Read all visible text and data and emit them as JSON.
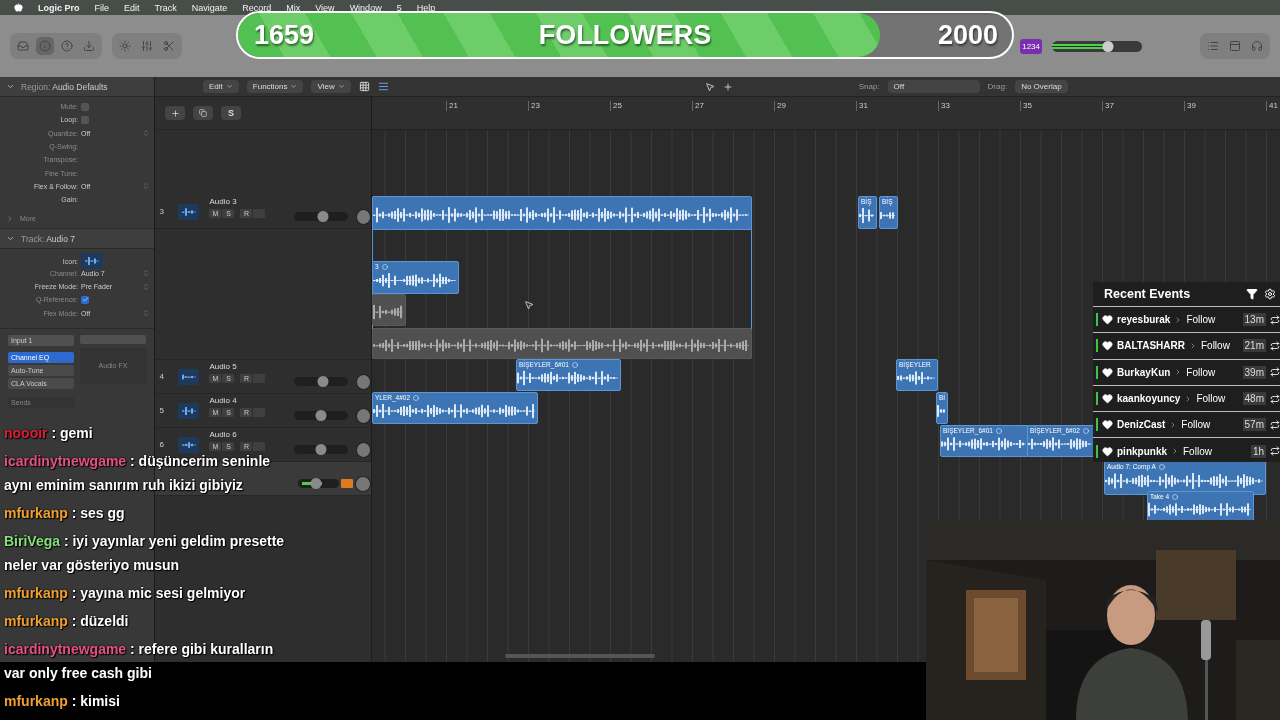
{
  "menu_bar": {
    "app": "Logic Pro",
    "items": [
      "File",
      "Edit",
      "Track",
      "Navigate",
      "Record",
      "Mix",
      "View",
      "Window",
      "5",
      "Help"
    ]
  },
  "followers_goal": {
    "current": "1659",
    "label": "FOLLOWERS",
    "goal": "2000",
    "level": 0.83
  },
  "control_bar": {
    "master_volume": {
      "level": 0.62
    },
    "badge": "1234"
  },
  "inspector": {
    "region_header": {
      "label": "Region:",
      "value": "Audio Defaults",
      "expanded": true
    },
    "region_rows": [
      {
        "label": "Mute:",
        "kind": "check",
        "checked": false,
        "disabled": true
      },
      {
        "label": "Loop:",
        "kind": "check",
        "checked": false,
        "disabled": false
      },
      {
        "label": "Quantize:",
        "kind": "value",
        "value": "Off",
        "disabled": true
      },
      {
        "label": "Q-Swing:",
        "kind": "blank",
        "disabled": true
      },
      {
        "label": "Transpose:",
        "kind": "blank",
        "disabled": true
      },
      {
        "label": "Fine Tune:",
        "kind": "blank",
        "disabled": true
      },
      {
        "label": "Flex & Follow:",
        "kind": "value",
        "value": "Off",
        "disabled": false
      },
      {
        "label": "Gain:",
        "kind": "blank",
        "disabled": false
      }
    ],
    "more": {
      "label": "More",
      "expanded": false
    },
    "track_header": {
      "label": "Track:",
      "value": "Audio 7",
      "expanded": true
    },
    "track_rows": [
      {
        "label": "Icon:",
        "kind": "icon",
        "disabled": false
      },
      {
        "label": "Channel:",
        "kind": "value",
        "value": "Audio 7",
        "disabled": true
      },
      {
        "label": "Freeze Mode:",
        "kind": "value",
        "value": "Pre Fader",
        "disabled": false
      },
      {
        "label": "Q-Reference:",
        "kind": "check",
        "checked": true,
        "disabled": true
      },
      {
        "label": "Flex Mode:",
        "kind": "value",
        "value": "Off",
        "disabled": true
      }
    ],
    "channel_strip": {
      "input": "Input 1",
      "plugins": [
        {
          "name": "Channel EQ",
          "selected": true
        },
        {
          "name": "Auto-Tune",
          "selected": false
        },
        {
          "name": "CLA Vocals",
          "selected": false
        }
      ],
      "audio_fx": "Audio FX",
      "sends": "Sends"
    }
  },
  "tracks_toolbar": {
    "menus": [
      "Edit",
      "Functions",
      "View"
    ],
    "snap_label": "Snap:",
    "snap_value": "Off",
    "drag_label": "Drag:",
    "drag_value": "No Overlap",
    "solo_button": "S"
  },
  "ruler": [
    "21",
    "23",
    "25",
    "27",
    "29",
    "31",
    "33",
    "35",
    "37",
    "39",
    "41"
  ],
  "tracks": [
    {
      "kind": "track",
      "number": "3",
      "name": "Audio 3",
      "mute": "M",
      "solo": "S",
      "record": "R",
      "monitoring": false,
      "level": 0.55
    },
    {
      "kind": "take-lanes"
    },
    {
      "kind": "track",
      "number": "4",
      "name": "Audio 5",
      "mute": "M",
      "solo": "S",
      "record": "R",
      "monitoring": false,
      "level": 0.55
    },
    {
      "kind": "track",
      "number": "5",
      "name": "Audio 4",
      "mute": "M",
      "solo": "S",
      "record": "R",
      "monitoring": false,
      "level": 0.5
    },
    {
      "kind": "track",
      "number": "6",
      "name": "Audio 6",
      "mute": "M",
      "solo": "S",
      "record": "R",
      "monitoring": false,
      "level": 0.5
    },
    {
      "kind": "track",
      "monitoring": true,
      "level": 0.45
    }
  ],
  "regions": [
    {
      "kind": "active"
    },
    {
      "kind": "active",
      "name": "3",
      "loop": true
    },
    {
      "kind": "inactive"
    },
    {
      "kind": "inactive"
    },
    {
      "kind": "active",
      "name": "BİŞ"
    },
    {
      "kind": "active",
      "name": "BİŞ"
    },
    {
      "kind": "active",
      "name": "BİŞEYLER_6#01",
      "loop": true
    },
    {
      "kind": "active",
      "name": "BİŞEYLER"
    },
    {
      "kind": "active",
      "name": "YLER_4#02",
      "loop": true
    },
    {
      "kind": "active",
      "name": "Bİ"
    },
    {
      "kind": "active",
      "name": "BİŞEYLER_6#01",
      "loop": true
    },
    {
      "kind": "active",
      "name": "BİŞEYLER_6#02",
      "loop": true
    },
    {
      "kind": "active",
      "name": "Audio 7: Comp A",
      "loop": true
    },
    {
      "kind": "active",
      "name": "Take 4",
      "loop": true
    }
  ],
  "recent_events": {
    "title": "Recent Events",
    "items": [
      {
        "user": "reyesburak",
        "action": "Follow",
        "time": "13m"
      },
      {
        "user": "BALTASHARR",
        "action": "Follow",
        "time": "21m"
      },
      {
        "user": "BurkayKun",
        "action": "Follow",
        "time": "39m"
      },
      {
        "user": "kaankoyuncy",
        "action": "Follow",
        "time": "48m"
      },
      {
        "user": "DenizCast",
        "action": "Follow",
        "time": "57m"
      },
      {
        "user": "pinkpunkk",
        "action": "Follow",
        "time": "1h"
      }
    ]
  },
  "chat": [
    {
      "user": "noooir",
      "color": "#d8203a",
      "message": ": gemi"
    },
    {
      "user": "icardinytnewgame",
      "color": "#e6527f",
      "message": ": düşüncerim seninle aynı eminim sanırım ruh ikizi gibiyiz"
    },
    {
      "user": "mfurkanp",
      "color": "#f0a030",
      "message": ": ses gg"
    },
    {
      "user": "BiriVega",
      "color": "#86e07a",
      "message": ": iyi yayınlar yeni geldim presette neler var gösteriyo musun"
    },
    {
      "user": "mfurkanp",
      "color": "#f0a030",
      "message": ": yayına mic sesi gelmiyor"
    },
    {
      "user": "mfurkanp",
      "color": "#f0a030",
      "message": ": düzeldi"
    },
    {
      "user": "icardinytnewgame",
      "color": "#e6527f",
      "message": ": refere gibi kuralların var only free cash gibi"
    },
    {
      "user": "mfurkanp",
      "color": "#f0a030",
      "message": ": kimisi"
    }
  ]
}
